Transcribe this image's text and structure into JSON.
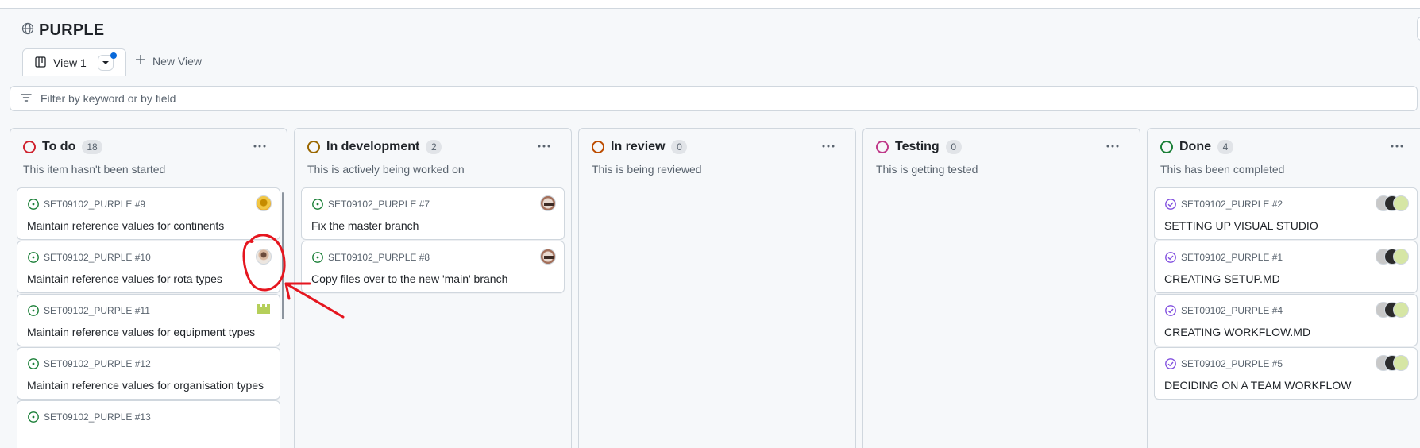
{
  "project": {
    "title": "PURPLE"
  },
  "views": {
    "active_tab": "View 1",
    "new_view_label": "New View"
  },
  "filter": {
    "placeholder": "Filter by keyword or by field"
  },
  "columns": [
    {
      "name": "To do",
      "count": "18",
      "description": "This item hasn't been started",
      "color": "#cf222e",
      "cards": [
        {
          "ref": "SET09102_PURPLE #9",
          "title": "Maintain reference values for continents",
          "avatar": "yellow-avatar"
        },
        {
          "ref": "SET09102_PURPLE #10",
          "title": "Maintain reference values for rota types",
          "avatar": "photo-avatar"
        },
        {
          "ref": "SET09102_PURPLE #11",
          "title": "Maintain reference values for equipment types",
          "avatar": "green-identicon"
        },
        {
          "ref": "SET09102_PURPLE #12",
          "title": "Maintain reference values for organisation types",
          "avatar": ""
        },
        {
          "ref": "SET09102_PURPLE #13",
          "title": "",
          "avatar": ""
        }
      ]
    },
    {
      "name": "In development",
      "count": "2",
      "description": "This is actively being worked on",
      "color": "#9a6700",
      "cards": [
        {
          "ref": "SET09102_PURPLE #7",
          "title": "Fix the master branch",
          "avatar": "text-avatar"
        },
        {
          "ref": "SET09102_PURPLE #8",
          "title": "Copy files over to the new 'main' branch",
          "avatar": "text-avatar"
        }
      ]
    },
    {
      "name": "In review",
      "count": "0",
      "description": "This is being reviewed",
      "color": "#bc4c00",
      "cards": []
    },
    {
      "name": "Testing",
      "count": "0",
      "description": "This is getting tested",
      "color": "#bf3989",
      "cards": []
    },
    {
      "name": "Done",
      "count": "4",
      "description": "This has been completed",
      "color": "#1a7f37",
      "cards": [
        {
          "ref": "SET09102_PURPLE #2",
          "title": "SETTING UP VISUAL STUDIO",
          "avatar": "stacked-avatars"
        },
        {
          "ref": "SET09102_PURPLE #1",
          "title": "CREATING SETUP.MD",
          "avatar": "stacked-avatars"
        },
        {
          "ref": "SET09102_PURPLE #4",
          "title": "CREATING WORKFLOW.MD",
          "avatar": "stacked-avatars"
        },
        {
          "ref": "SET09102_PURPLE #5",
          "title": "DECIDING ON A TEAM WORKFLOW",
          "avatar": "stacked-avatars"
        }
      ]
    }
  ],
  "colors": {
    "open_issue": "#1a7f37",
    "closed_issue": "#8250df",
    "annotation": "#e5161f",
    "accent": "#0969da"
  },
  "icons": {
    "project": "globe-icon",
    "board_view": "table-board-icon",
    "add": "plus-icon",
    "filter": "filter-icon",
    "column_menu": "kebab-horizontal-icon",
    "open_issue": "issue-opened-icon",
    "closed_issue": "issue-closed-icon"
  }
}
